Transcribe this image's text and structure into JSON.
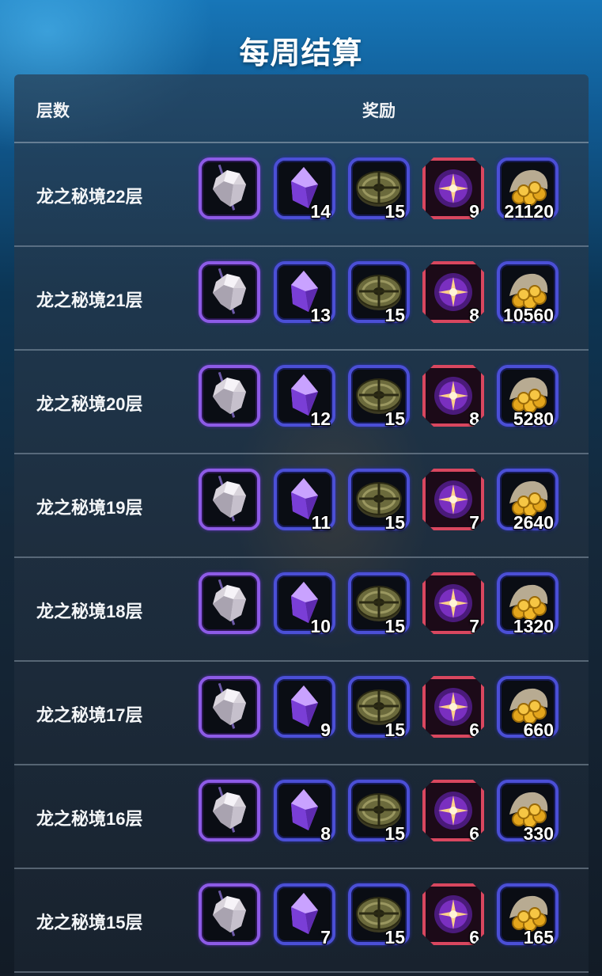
{
  "title": "每周结算",
  "header": {
    "floor_label": "层数",
    "reward_label": "奖励"
  },
  "rows": [
    {
      "floor": "龙之秘境22层",
      "crystal": "14",
      "disc": "15",
      "orb": "9",
      "gold": "21120"
    },
    {
      "floor": "龙之秘境21层",
      "crystal": "13",
      "disc": "15",
      "orb": "8",
      "gold": "10560"
    },
    {
      "floor": "龙之秘境20层",
      "crystal": "12",
      "disc": "15",
      "orb": "8",
      "gold": "5280"
    },
    {
      "floor": "龙之秘境19层",
      "crystal": "11",
      "disc": "15",
      "orb": "7",
      "gold": "2640"
    },
    {
      "floor": "龙之秘境18层",
      "crystal": "10",
      "disc": "15",
      "orb": "7",
      "gold": "1320"
    },
    {
      "floor": "龙之秘境17层",
      "crystal": "9",
      "disc": "15",
      "orb": "6",
      "gold": "660"
    },
    {
      "floor": "龙之秘境16层",
      "crystal": "8",
      "disc": "15",
      "orb": "6",
      "gold": "330"
    },
    {
      "floor": "龙之秘境15层",
      "crystal": "7",
      "disc": "15",
      "orb": "6",
      "gold": "165"
    }
  ],
  "reward_icons": [
    "white-ore-icon",
    "purple-crystal-icon",
    "bronze-disc-icon",
    "purple-orb-icon",
    "gold-coins-icon"
  ],
  "colors": {
    "purple_frame": "#8d5be6",
    "blue_frame": "#4b4fd6",
    "red_frame": "#d9475f"
  }
}
